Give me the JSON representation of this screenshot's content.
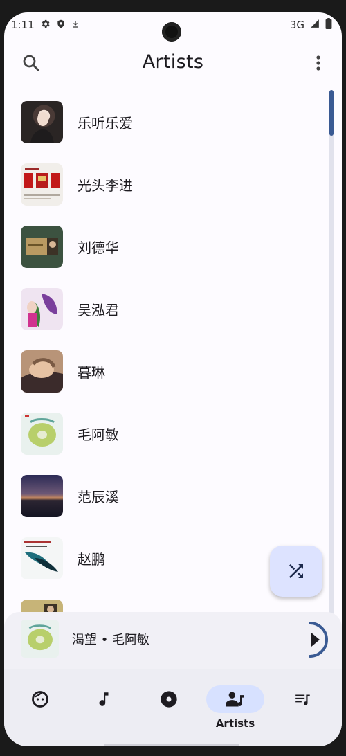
{
  "status": {
    "time": "1:11",
    "network": "3G"
  },
  "app_bar": {
    "title": "Artists"
  },
  "artists": [
    {
      "name": "乐听乐爱"
    },
    {
      "name": "光头李进"
    },
    {
      "name": "刘德华"
    },
    {
      "name": "吴泓君"
    },
    {
      "name": "暮琳"
    },
    {
      "name": "毛阿敏"
    },
    {
      "name": "范辰溪"
    },
    {
      "name": "赵鹏"
    }
  ],
  "now_playing": {
    "text": "渴望 • 毛阿敏"
  },
  "bottom_nav": {
    "active_label": "Artists"
  },
  "colors": {
    "accent": "#3a5a93",
    "active_pill": "#d7e1ff",
    "fab": "#dde3ff"
  }
}
